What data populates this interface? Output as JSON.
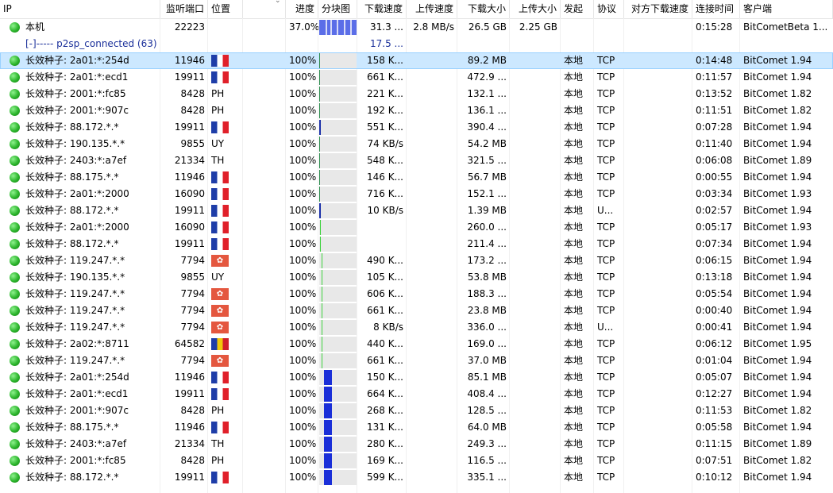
{
  "columns": [
    "IP",
    "监听端口",
    "位置",
    "",
    "进度",
    "分块图",
    "下载速度",
    "上传速度",
    "下载大小",
    "上传大小",
    "发起",
    "协议",
    "对方下载速度",
    "连接时间",
    "客户端"
  ],
  "colors": {
    "fr": "#1e3da8",
    "dl_bar": "#1a2fd8",
    "selected": "#cce8ff"
  },
  "summary": {
    "ip": "本机",
    "port": "22223",
    "progress": "37.0%",
    "dl_speed": "31.3 ...",
    "ul_speed": "2.8 MB/s",
    "dl_size": "26.5 GB",
    "ul_size": "2.25 GB",
    "time": "0:15:28",
    "client": "BitCometBeta 1..."
  },
  "subheader": {
    "label": "[-]----- p2sp_connected (63)",
    "dl_speed": "17.5 ..."
  },
  "rows": [
    {
      "ip": "长效种子: 2a01:*:254d",
      "port": "11946",
      "loc": "fr",
      "progress": "100%",
      "dl": "158 K...",
      "size": "89.2 MB",
      "init": "本地",
      "proto": "TCP",
      "time": "0:14:48",
      "client": "BitComet 1.94",
      "bar": "thin",
      "sel": true
    },
    {
      "ip": "长效种子: 2a01:*:ecd1",
      "port": "19911",
      "loc": "fr",
      "progress": "100%",
      "dl": "661 K...",
      "size": "472.9 ...",
      "init": "本地",
      "proto": "TCP",
      "time": "0:11:57",
      "client": "BitComet 1.94",
      "bar": "thin"
    },
    {
      "ip": "长效种子: 2001:*:fc85",
      "port": "8428",
      "loc": "PH",
      "progress": "100%",
      "dl": "221 K...",
      "size": "132.1 ...",
      "init": "本地",
      "proto": "TCP",
      "time": "0:13:52",
      "client": "BitComet 1.82",
      "bar": "thin"
    },
    {
      "ip": "长效种子: 2001:*:907c",
      "port": "8428",
      "loc": "PH",
      "progress": "100%",
      "dl": "192 K...",
      "size": "136.1 ...",
      "init": "本地",
      "proto": "TCP",
      "time": "0:11:51",
      "client": "BitComet 1.82",
      "bar": "thin"
    },
    {
      "ip": "长效种子: 88.172.*.*",
      "port": "19911",
      "loc": "fr",
      "progress": "100%",
      "dl": "551 K...",
      "size": "390.4 ...",
      "init": "本地",
      "proto": "TCP",
      "time": "0:07:28",
      "client": "BitComet 1.94",
      "bar": "thinblue"
    },
    {
      "ip": "长效种子: 190.135.*.*",
      "port": "9855",
      "loc": "UY",
      "progress": "100%",
      "dl": "74 KB/s",
      "size": "54.2 MB",
      "init": "本地",
      "proto": "TCP",
      "time": "0:11:40",
      "client": "BitComet 1.94",
      "bar": "thin"
    },
    {
      "ip": "长效种子: 2403:*:a7ef",
      "port": "21334",
      "loc": "TH",
      "progress": "100%",
      "dl": "548 K...",
      "size": "321.5 ...",
      "init": "本地",
      "proto": "TCP",
      "time": "0:06:08",
      "client": "BitComet 1.89",
      "bar": "thin"
    },
    {
      "ip": "长效种子: 88.175.*.*",
      "port": "11946",
      "loc": "fr",
      "progress": "100%",
      "dl": "146 K...",
      "size": "56.7 MB",
      "init": "本地",
      "proto": "TCP",
      "time": "0:00:55",
      "client": "BitComet 1.94",
      "bar": "thin"
    },
    {
      "ip": "长效种子: 2a01:*:2000",
      "port": "16090",
      "loc": "fr",
      "progress": "100%",
      "dl": "716 K...",
      "size": "152.1 ...",
      "init": "本地",
      "proto": "TCP",
      "time": "0:03:34",
      "client": "BitComet 1.93",
      "bar": "thin"
    },
    {
      "ip": "长效种子: 88.172.*.*",
      "port": "19911",
      "loc": "fr",
      "progress": "100%",
      "dl": "10 KB/s",
      "size": "1.39 MB",
      "init": "本地",
      "proto": "U...",
      "time": "0:02:57",
      "client": "BitComet 1.94",
      "bar": "thinblue"
    },
    {
      "ip": "长效种子: 2a01:*:2000",
      "port": "16090",
      "loc": "fr",
      "progress": "100%",
      "dl": "",
      "size": "260.0 ...",
      "init": "本地",
      "proto": "TCP",
      "time": "0:05:17",
      "client": "BitComet 1.93",
      "bar": "green"
    },
    {
      "ip": "长效种子: 88.172.*.*",
      "port": "19911",
      "loc": "fr",
      "progress": "100%",
      "dl": "",
      "size": "211.4 ...",
      "init": "本地",
      "proto": "TCP",
      "time": "0:07:34",
      "client": "BitComet 1.94",
      "bar": "green"
    },
    {
      "ip": "长效种子: 119.247.*.*",
      "port": "7794",
      "loc": "hk",
      "progress": "100%",
      "dl": "490 K...",
      "size": "173.2 ...",
      "init": "本地",
      "proto": "TCP",
      "time": "0:06:15",
      "client": "BitComet 1.94",
      "bar": "green2"
    },
    {
      "ip": "长效种子: 190.135.*.*",
      "port": "9855",
      "loc": "UY",
      "progress": "100%",
      "dl": "105 K...",
      "size": "53.8 MB",
      "init": "本地",
      "proto": "TCP",
      "time": "0:13:18",
      "client": "BitComet 1.94",
      "bar": "green2"
    },
    {
      "ip": "长效种子: 119.247.*.*",
      "port": "7794",
      "loc": "hk",
      "progress": "100%",
      "dl": "606 K...",
      "size": "188.3 ...",
      "init": "本地",
      "proto": "TCP",
      "time": "0:05:54",
      "client": "BitComet 1.94",
      "bar": "green2"
    },
    {
      "ip": "长效种子: 119.247.*.*",
      "port": "7794",
      "loc": "hk",
      "progress": "100%",
      "dl": "661 K...",
      "size": "23.8 MB",
      "init": "本地",
      "proto": "TCP",
      "time": "0:00:40",
      "client": "BitComet 1.94",
      "bar": "green2"
    },
    {
      "ip": "长效种子: 119.247.*.*",
      "port": "7794",
      "loc": "hk",
      "progress": "100%",
      "dl": "8 KB/s",
      "size": "336.0 ...",
      "init": "本地",
      "proto": "U...",
      "time": "0:00:41",
      "client": "BitComet 1.94",
      "bar": "green2"
    },
    {
      "ip": "长效种子: 2a02:*:8711",
      "port": "64582",
      "loc": "ro",
      "progress": "100%",
      "dl": "440 K...",
      "size": "169.0 ...",
      "init": "本地",
      "proto": "TCP",
      "time": "0:06:12",
      "client": "BitComet 1.95",
      "bar": "green2"
    },
    {
      "ip": "长效种子: 119.247.*.*",
      "port": "7794",
      "loc": "hk",
      "progress": "100%",
      "dl": "661 K...",
      "size": "37.0 MB",
      "init": "本地",
      "proto": "TCP",
      "time": "0:01:04",
      "client": "BitComet 1.94",
      "bar": "green2"
    },
    {
      "ip": "长效种子: 2a01:*:254d",
      "port": "11946",
      "loc": "fr",
      "progress": "100%",
      "dl": "150 K...",
      "size": "85.1 MB",
      "init": "本地",
      "proto": "TCP",
      "time": "0:05:07",
      "client": "BitComet 1.94",
      "bar": "blue"
    },
    {
      "ip": "长效种子: 2a01:*:ecd1",
      "port": "19911",
      "loc": "fr",
      "progress": "100%",
      "dl": "664 K...",
      "size": "408.4 ...",
      "init": "本地",
      "proto": "TCP",
      "time": "0:12:27",
      "client": "BitComet 1.94",
      "bar": "blue"
    },
    {
      "ip": "长效种子: 2001:*:907c",
      "port": "8428",
      "loc": "PH",
      "progress": "100%",
      "dl": "268 K...",
      "size": "128.5 ...",
      "init": "本地",
      "proto": "TCP",
      "time": "0:11:53",
      "client": "BitComet 1.82",
      "bar": "blue"
    },
    {
      "ip": "长效种子: 88.175.*.*",
      "port": "11946",
      "loc": "fr",
      "progress": "100%",
      "dl": "131 K...",
      "size": "64.0 MB",
      "init": "本地",
      "proto": "TCP",
      "time": "0:05:58",
      "client": "BitComet 1.94",
      "bar": "blue"
    },
    {
      "ip": "长效种子: 2403:*:a7ef",
      "port": "21334",
      "loc": "TH",
      "progress": "100%",
      "dl": "280 K...",
      "size": "249.3 ...",
      "init": "本地",
      "proto": "TCP",
      "time": "0:11:15",
      "client": "BitComet 1.89",
      "bar": "blue"
    },
    {
      "ip": "长效种子: 2001:*:fc85",
      "port": "8428",
      "loc": "PH",
      "progress": "100%",
      "dl": "169 K...",
      "size": "116.5 ...",
      "init": "本地",
      "proto": "TCP",
      "time": "0:07:51",
      "client": "BitComet 1.82",
      "bar": "blue"
    },
    {
      "ip": "长效种子: 88.172.*.*",
      "port": "19911",
      "loc": "fr",
      "progress": "100%",
      "dl": "599 K...",
      "size": "335.1 ...",
      "init": "本地",
      "proto": "TCP",
      "time": "0:10:12",
      "client": "BitComet 1.94",
      "bar": "blue"
    }
  ]
}
